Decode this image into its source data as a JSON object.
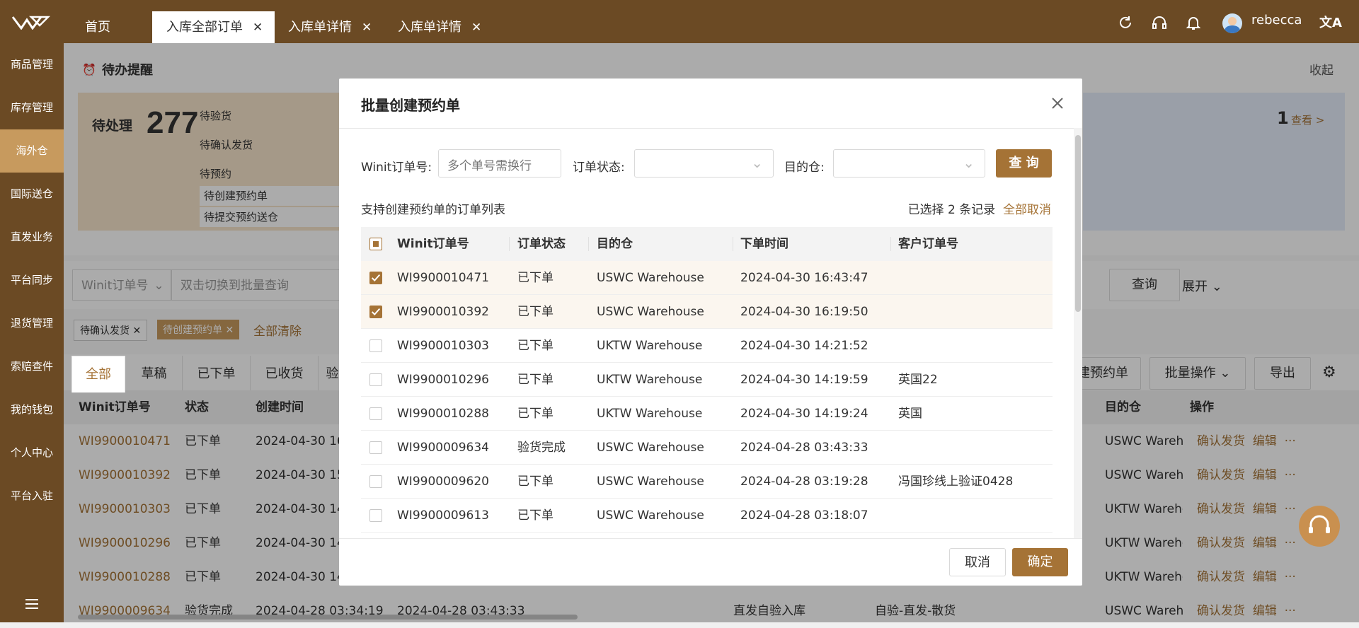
{
  "topbar": {
    "tabs": [
      {
        "label": "首页"
      },
      {
        "label": "入库全部订单"
      },
      {
        "label": "入库单详情"
      },
      {
        "label": "入库单详情"
      }
    ],
    "username": "rebecca"
  },
  "sidebar": {
    "items": [
      {
        "label": "商品管理"
      },
      {
        "label": "库存管理"
      },
      {
        "label": "海外仓"
      },
      {
        "label": "国际送仓"
      },
      {
        "label": "直发业务"
      },
      {
        "label": "平台同步"
      },
      {
        "label": "退货管理"
      },
      {
        "label": "索赔查件"
      },
      {
        "label": "我的钱包"
      },
      {
        "label": "个人中心"
      },
      {
        "label": "平台入驻"
      }
    ]
  },
  "todo": {
    "title": "待办提醒",
    "collapse": "收起",
    "pending_label": "待处理",
    "pending_count": "277",
    "items": [
      "待验货",
      "待确认发货",
      "待预约"
    ],
    "subitems": [
      "待创建预约单",
      "待提交预约送仓"
    ],
    "right_count": "1",
    "right_link": "查看 >"
  },
  "search": {
    "field_select": "Winit订单号",
    "placeholder": "双击切换到批量查询",
    "query_btn": "查询",
    "expand": "展开"
  },
  "filters": {
    "tags": [
      "待确认发货",
      "待创建预约单"
    ],
    "clear_all": "全部清除"
  },
  "status_tabs": [
    "全部",
    "草稿",
    "已下单",
    "已收货",
    "验"
  ],
  "actions": {
    "create": "建预约单",
    "batch": "批量操作",
    "export": "导出"
  },
  "grid": {
    "headers": [
      "Winit订单号",
      "状态",
      "创建时间",
      "目的仓",
      "操作"
    ],
    "rows": [
      {
        "id": "WI9900010471",
        "status": "已下单",
        "created": "2024-04-30 16:4",
        "wh": "USWC Wareho"
      },
      {
        "id": "WI9900010392",
        "status": "已下单",
        "created": "2024-04-30 15:",
        "wh": "USWC Wareho"
      },
      {
        "id": "WI9900010303",
        "status": "已下单",
        "created": "2024-04-30 14:",
        "wh": "UKTW Wareho"
      },
      {
        "id": "WI9900010296",
        "status": "已下单",
        "created": "2024-04-30 14:",
        "wh": "UKTW Wareho"
      },
      {
        "id": "WI9900010288",
        "status": "已下单",
        "created": "2024-04-30 14:",
        "wh": "UKTW Wareho"
      },
      {
        "id": "WI9900009634",
        "status": "验货完成",
        "created": "2024-04-28 03:34:19",
        "created2": "2024-04-28 03:43:33",
        "col_a": "直发自验入库",
        "col_b": "自验-直发-散货",
        "wh": "USWC Wareho"
      }
    ],
    "op_confirm": "确认发货",
    "op_edit": "编辑",
    "op_more": "···"
  },
  "modal": {
    "title": "批量创建预约单",
    "order_no_label": "Winit订单号:",
    "order_no_placeholder": "多个单号需换行",
    "status_label": "订单状态:",
    "wh_label": "目的仓:",
    "query": "查 询",
    "list_title": "支持创建预约单的订单列表",
    "selected_text": "已选择 2 条记录",
    "cancel_all": "全部取消",
    "headers": [
      "Winit订单号",
      "订单状态",
      "目的仓",
      "下单时间",
      "客户订单号"
    ],
    "rows": [
      {
        "id": "WI9900010471",
        "status": "已下单",
        "wh": "USWC Warehouse",
        "time": "2024-04-30 16:43:47",
        "cust": "",
        "checked": true
      },
      {
        "id": "WI9900010392",
        "status": "已下单",
        "wh": "USWC Warehouse",
        "time": "2024-04-30 16:19:50",
        "cust": "",
        "checked": true
      },
      {
        "id": "WI9900010303",
        "status": "已下单",
        "wh": "UKTW Warehouse",
        "time": "2024-04-30 14:21:52",
        "cust": "",
        "checked": false
      },
      {
        "id": "WI9900010296",
        "status": "已下单",
        "wh": "UKTW Warehouse",
        "time": "2024-04-30 14:19:59",
        "cust": "英国22",
        "checked": false
      },
      {
        "id": "WI9900010288",
        "status": "已下单",
        "wh": "UKTW Warehouse",
        "time": "2024-04-30 14:19:24",
        "cust": "英国",
        "checked": false
      },
      {
        "id": "WI9900009634",
        "status": "验货完成",
        "wh": "USWC Warehouse",
        "time": "2024-04-28 03:43:33",
        "cust": "",
        "checked": false
      },
      {
        "id": "WI9900009620",
        "status": "已下单",
        "wh": "USWC Warehouse",
        "time": "2024-04-28 03:19:28",
        "cust": "冯国珍线上验证0428",
        "checked": false
      },
      {
        "id": "WI9900009613",
        "status": "已下单",
        "wh": "USWC Warehouse",
        "time": "2024-04-28 03:18:07",
        "cust": "",
        "checked": false
      }
    ],
    "cancel_btn": "取消",
    "confirm_btn": "确定"
  },
  "colors": {
    "brand": "#6b4a24",
    "accent": "#a57336",
    "active_side": "#c79a5e"
  }
}
